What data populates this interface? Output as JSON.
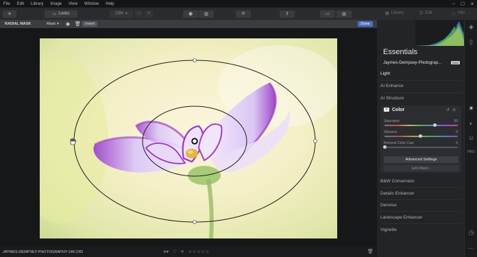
{
  "menubar": {
    "items": [
      "File",
      "Edit",
      "Library",
      "Image",
      "View",
      "Window",
      "Help"
    ]
  },
  "toolbar": {
    "add_label": "+",
    "looks_label": "Looks",
    "zoom_value": "23%",
    "zoom_minus": "−",
    "zoom_plus": "+"
  },
  "right_tabs": {
    "library_label": "Library",
    "edit_label": "Edit",
    "info_label": "Info"
  },
  "mask_bar": {
    "title": "RADIAL MASK",
    "mask_dropdown": "Mask",
    "invert_label": "Invert",
    "done_label": "Done"
  },
  "status_bar": {
    "filename": "JAYMES-DEMPSEY-PHOTOGRAPHY-146.CR2",
    "rating_stars": 5
  },
  "panel": {
    "title": "Essentials",
    "preset_name": "Jaymes-Dempsey-Photograp...",
    "preset_badge": "RAW",
    "sections": {
      "light": "Light",
      "ai_enhance": "AI Enhance",
      "ai_structure": "AI Structure",
      "color": "Color",
      "bw": "B&W Conversion",
      "details": "Details Enhancer",
      "denoise": "Denoise",
      "landscape": "Landscape Enhancer",
      "vignette": "Vignette"
    },
    "sliders": {
      "saturation_label": "Saturation",
      "saturation_value": "39",
      "vibrance_label": "Vibrance",
      "vibrance_value": "0",
      "remove_cast_label": "Remove Color Cast",
      "remove_cast_value": "0"
    },
    "advanced_settings_label": "Advanced Settings",
    "edit_mask_label": "Edit Mask ›"
  },
  "colors": {
    "accent": "#4a73c8",
    "panel_bg": "#232427",
    "menubar_bg": "#141516"
  }
}
